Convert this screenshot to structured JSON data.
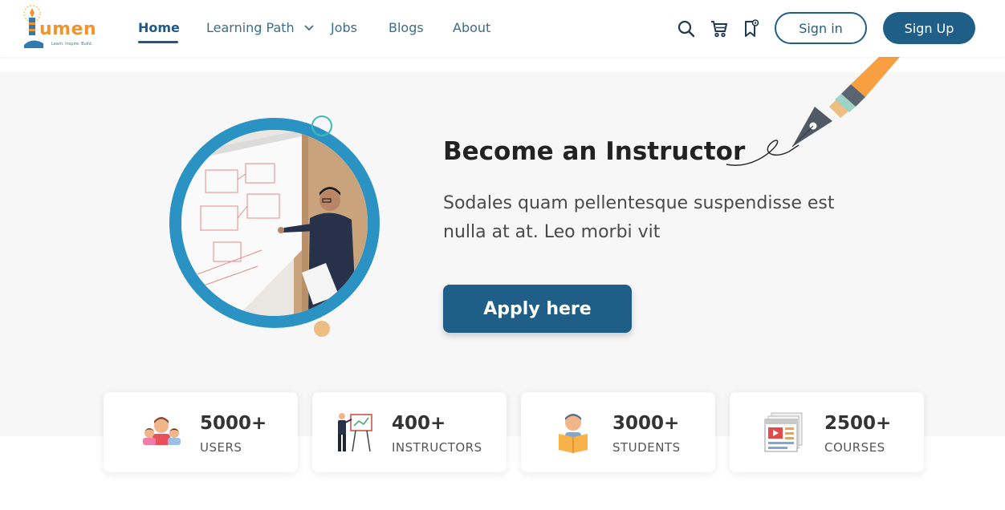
{
  "logo": {
    "word": "umen",
    "tagline": "Learn. Inspire. Build."
  },
  "nav": {
    "items": [
      {
        "label": "Home",
        "active": true
      },
      {
        "label": "Learning Path",
        "has_dropdown": true
      },
      {
        "label": "Jobs"
      },
      {
        "label": "Blogs"
      },
      {
        "label": "About"
      }
    ]
  },
  "header_icons": [
    "search-icon",
    "cart-icon",
    "bookmark-icon"
  ],
  "auth": {
    "signin_label": "Sign in",
    "signup_label": "Sign Up"
  },
  "hero": {
    "title": "Become an Instructor",
    "description": "Sodales quam pellentesque suspendisse est nulla at at. Leo morbi vit",
    "cta_label": "Apply here"
  },
  "stats": [
    {
      "value": "5000+",
      "label": "USERS",
      "icon": "users-icon"
    },
    {
      "value": "400+",
      "label": "INSTRUCTORS",
      "icon": "instructor-icon"
    },
    {
      "value": "3000+",
      "label": "STUDENTS",
      "icon": "student-icon"
    },
    {
      "value": "2500+",
      "label": "COURSES",
      "icon": "courses-icon"
    }
  ],
  "colors": {
    "primary": "#1f5e86",
    "accent_blue": "#2a93c4",
    "logo_orange": "#f2932b",
    "hero_bg": "#f7f7f7"
  }
}
